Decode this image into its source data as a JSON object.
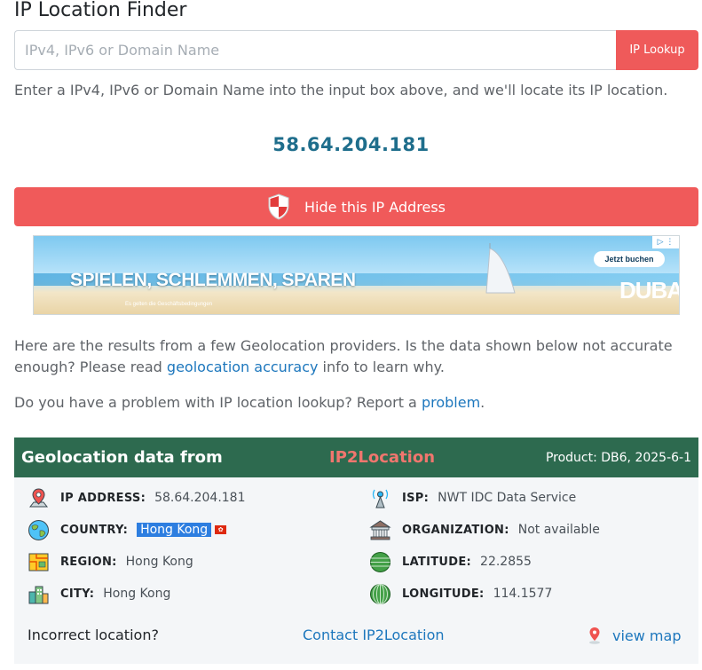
{
  "page": {
    "title": "IP Location Finder"
  },
  "search": {
    "placeholder": "IPv4, IPv6 or Domain Name",
    "value": "",
    "button_label": "IP Lookup"
  },
  "instruction": "Enter a IPv4, IPv6 or Domain Name into the input box above, and we'll locate its IP location.",
  "current_ip": "58.64.204.181",
  "hide_button": {
    "label": "Hide this IP Address"
  },
  "ad": {
    "headline": "SPIELEN, SCHLEMMEN, SPAREN",
    "fine_print": "Es gelten die Geschäftsbedingungen",
    "cta": "Jetzt buchen",
    "brand": "DUBAI",
    "adchoices": "▷ ⋮"
  },
  "info": {
    "para1_pre": "Here are the results from a few Geolocation providers. Is the data shown below not accurate",
    "para1_line2_pre": "enough? Please read ",
    "para1_link": "geolocation accuracy",
    "para1_post": " info to learn why.",
    "para2_pre": "Do you have a problem with IP location lookup? Report a ",
    "para2_link": "problem",
    "para2_post": "."
  },
  "geo": {
    "header_lead": "Geolocation data from",
    "provider": "IP2Location",
    "product": "Product: DB6, 2025-6-1",
    "left": [
      {
        "label": "IP ADDRESS:",
        "value": "58.64.204.181",
        "icon": "map-pin-icon"
      },
      {
        "label": "COUNTRY:",
        "value": "Hong Kong",
        "icon": "globe-icon",
        "flag": "✿"
      },
      {
        "label": "REGION:",
        "value": "Hong Kong",
        "icon": "region-map-icon"
      },
      {
        "label": "CITY:",
        "value": "Hong Kong",
        "icon": "city-icon"
      }
    ],
    "right": [
      {
        "label": "ISP:",
        "value": "NWT IDC Data Service",
        "icon": "antenna-icon"
      },
      {
        "label": "ORGANIZATION:",
        "value": "Not available",
        "icon": "building-icon"
      },
      {
        "label": "LATITUDE:",
        "value": "22.2855",
        "icon": "latitude-icon"
      },
      {
        "label": "LONGITUDE:",
        "value": "114.1577",
        "icon": "longitude-icon"
      }
    ],
    "incorrect_label": "Incorrect location?",
    "contact_link": "Contact IP2Location",
    "view_map": "view map"
  },
  "colors": {
    "accent_red": "#f05a5a",
    "header_green": "#2d6a4f",
    "link_blue": "#1d77bd",
    "ip_blue": "#1f6e8c"
  }
}
